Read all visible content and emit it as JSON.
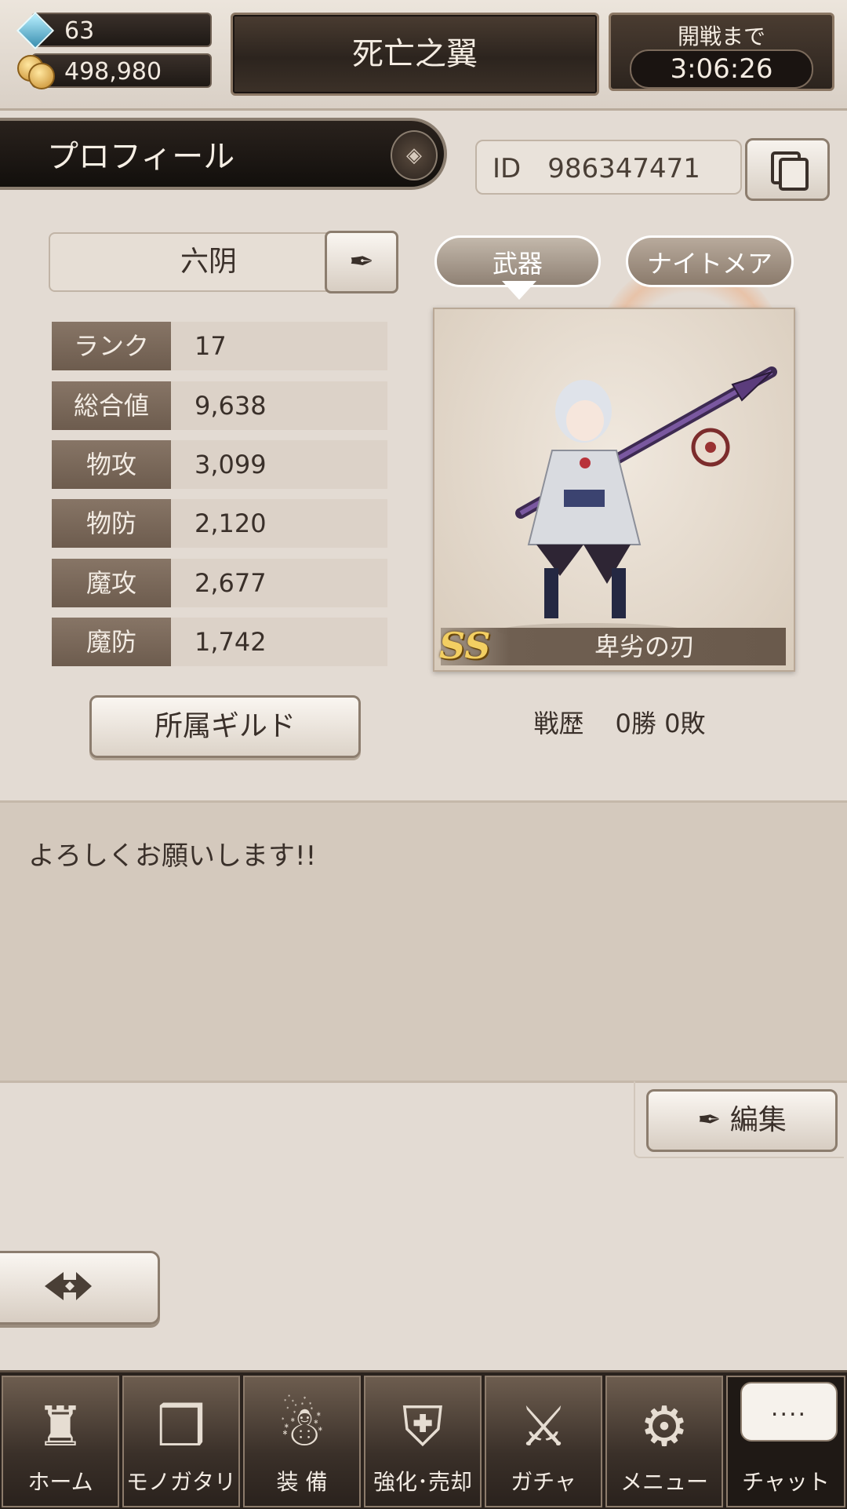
{
  "hud": {
    "gems": "63",
    "coins": "498,980",
    "guild_title": "死亡之翼",
    "timer_label": "開戦まで",
    "timer_value": "3:06:26"
  },
  "profile": {
    "banner_title": "プロフィール",
    "id_label": "ID",
    "id_value": "986347471",
    "name": "六阴",
    "stats": [
      {
        "label": "ランク",
        "value": "17"
      },
      {
        "label": "総合値",
        "value": "9,638"
      },
      {
        "label": "物攻",
        "value": "3,099"
      },
      {
        "label": "物防",
        "value": "2,120"
      },
      {
        "label": "魔攻",
        "value": "2,677"
      },
      {
        "label": "魔防",
        "value": "1,742"
      }
    ],
    "guild_button": "所属ギルド"
  },
  "tabs": {
    "weapon": "武器",
    "nightmare": "ナイトメア"
  },
  "weapon": {
    "rarity": "SS",
    "name": "卑劣の刃"
  },
  "record": {
    "label": "戦歴",
    "wins": "0勝",
    "losses": "0敗"
  },
  "comment": {
    "text": "よろしくお願いします!!"
  },
  "edit_button": "編集",
  "nav": {
    "items": [
      {
        "label": "ホーム",
        "icon": "castle-icon"
      },
      {
        "label": "モノガタリ",
        "icon": "book-icon"
      },
      {
        "label": "装 備",
        "icon": "puppet-icon"
      },
      {
        "label": "強化･売却",
        "icon": "helmet-icon"
      },
      {
        "label": "ガチャ",
        "icon": "crossed-swords-icon"
      },
      {
        "label": "メニュー",
        "icon": "gears-icon"
      },
      {
        "label": "チャット",
        "icon": "chat-bubble-icon",
        "bubble": "...."
      }
    ]
  },
  "colors": {
    "panel_dark": "#2a221d",
    "stat_label_bg": "#7a6859",
    "background": "#e3dbd3",
    "rarity_gold": "#f3cf62"
  }
}
